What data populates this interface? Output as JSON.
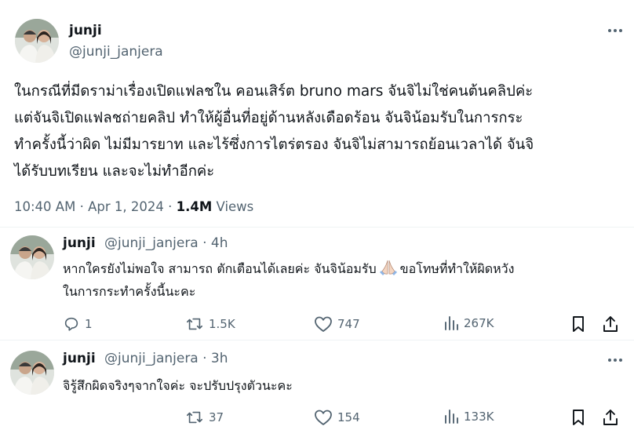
{
  "main_tweet": {
    "display_name": "junji",
    "handle": "@junji_janjera",
    "text_lines": [
      "ในกรณีที่มีดราม่าเรื่องเปิดแฟลชใน คอนเสิร์ต bruno mars จันจิไม่ใช่คนต้นคลิปค่ะ",
      "แต่จันจิเปิดแฟลชถ่ายคลิป ทำให้ผู้อื่นที่อยู่ด้านหลังเดือดร้อน จันจิน้อมรับในการกระ",
      "ทำครั้งนี้ว่าผิด ไม่มีมารยาท และไร้ซึ่งการไตร่ตรอง จันจิไม่สามารถย้อนเวลาได้ จันจิ",
      "ได้รับบทเรียน และจะไม่ทำอีกค่ะ"
    ],
    "time": "10:40 AM",
    "date": "Apr 1, 2024",
    "views_count": "1.4M",
    "views_label": "Views"
  },
  "replies": [
    {
      "display_name": "junji",
      "handle_time": "@junji_janjera · 4h",
      "line1_before_emoji": "หากใครยังไม่พอใจ สามารถ ตักเตือนได้เลยค่ะ จันจิน้อมรับ",
      "line1_after_emoji": "ขอโทษที่ทำให้ผิดหวัง",
      "line2": "ในการกระทำครั้งนี้นะคะ",
      "replies": "1",
      "retweets": "1.5K",
      "likes": "747",
      "views": "267K"
    },
    {
      "display_name": "junji",
      "handle_time": "@junji_janjera · 3h",
      "line1": "จิรู้สึกผิดจริงๆจากใจค่ะ จะปรับปรุงตัวนะคะ",
      "replies": "",
      "retweets": "37",
      "likes": "154",
      "views": "133K"
    }
  ],
  "colors": {
    "text_primary": "#0f1419",
    "text_secondary": "#536471",
    "divider": "#eff3f4"
  },
  "icons": {
    "more": "more-dots-icon",
    "reply": "speech-bubble-icon",
    "retweet": "retweet-arrows-icon",
    "like": "heart-icon",
    "views": "bar-chart-icon",
    "bookmark": "bookmark-icon",
    "share": "share-arrow-icon",
    "emoji": "folded-hands-emoji"
  }
}
